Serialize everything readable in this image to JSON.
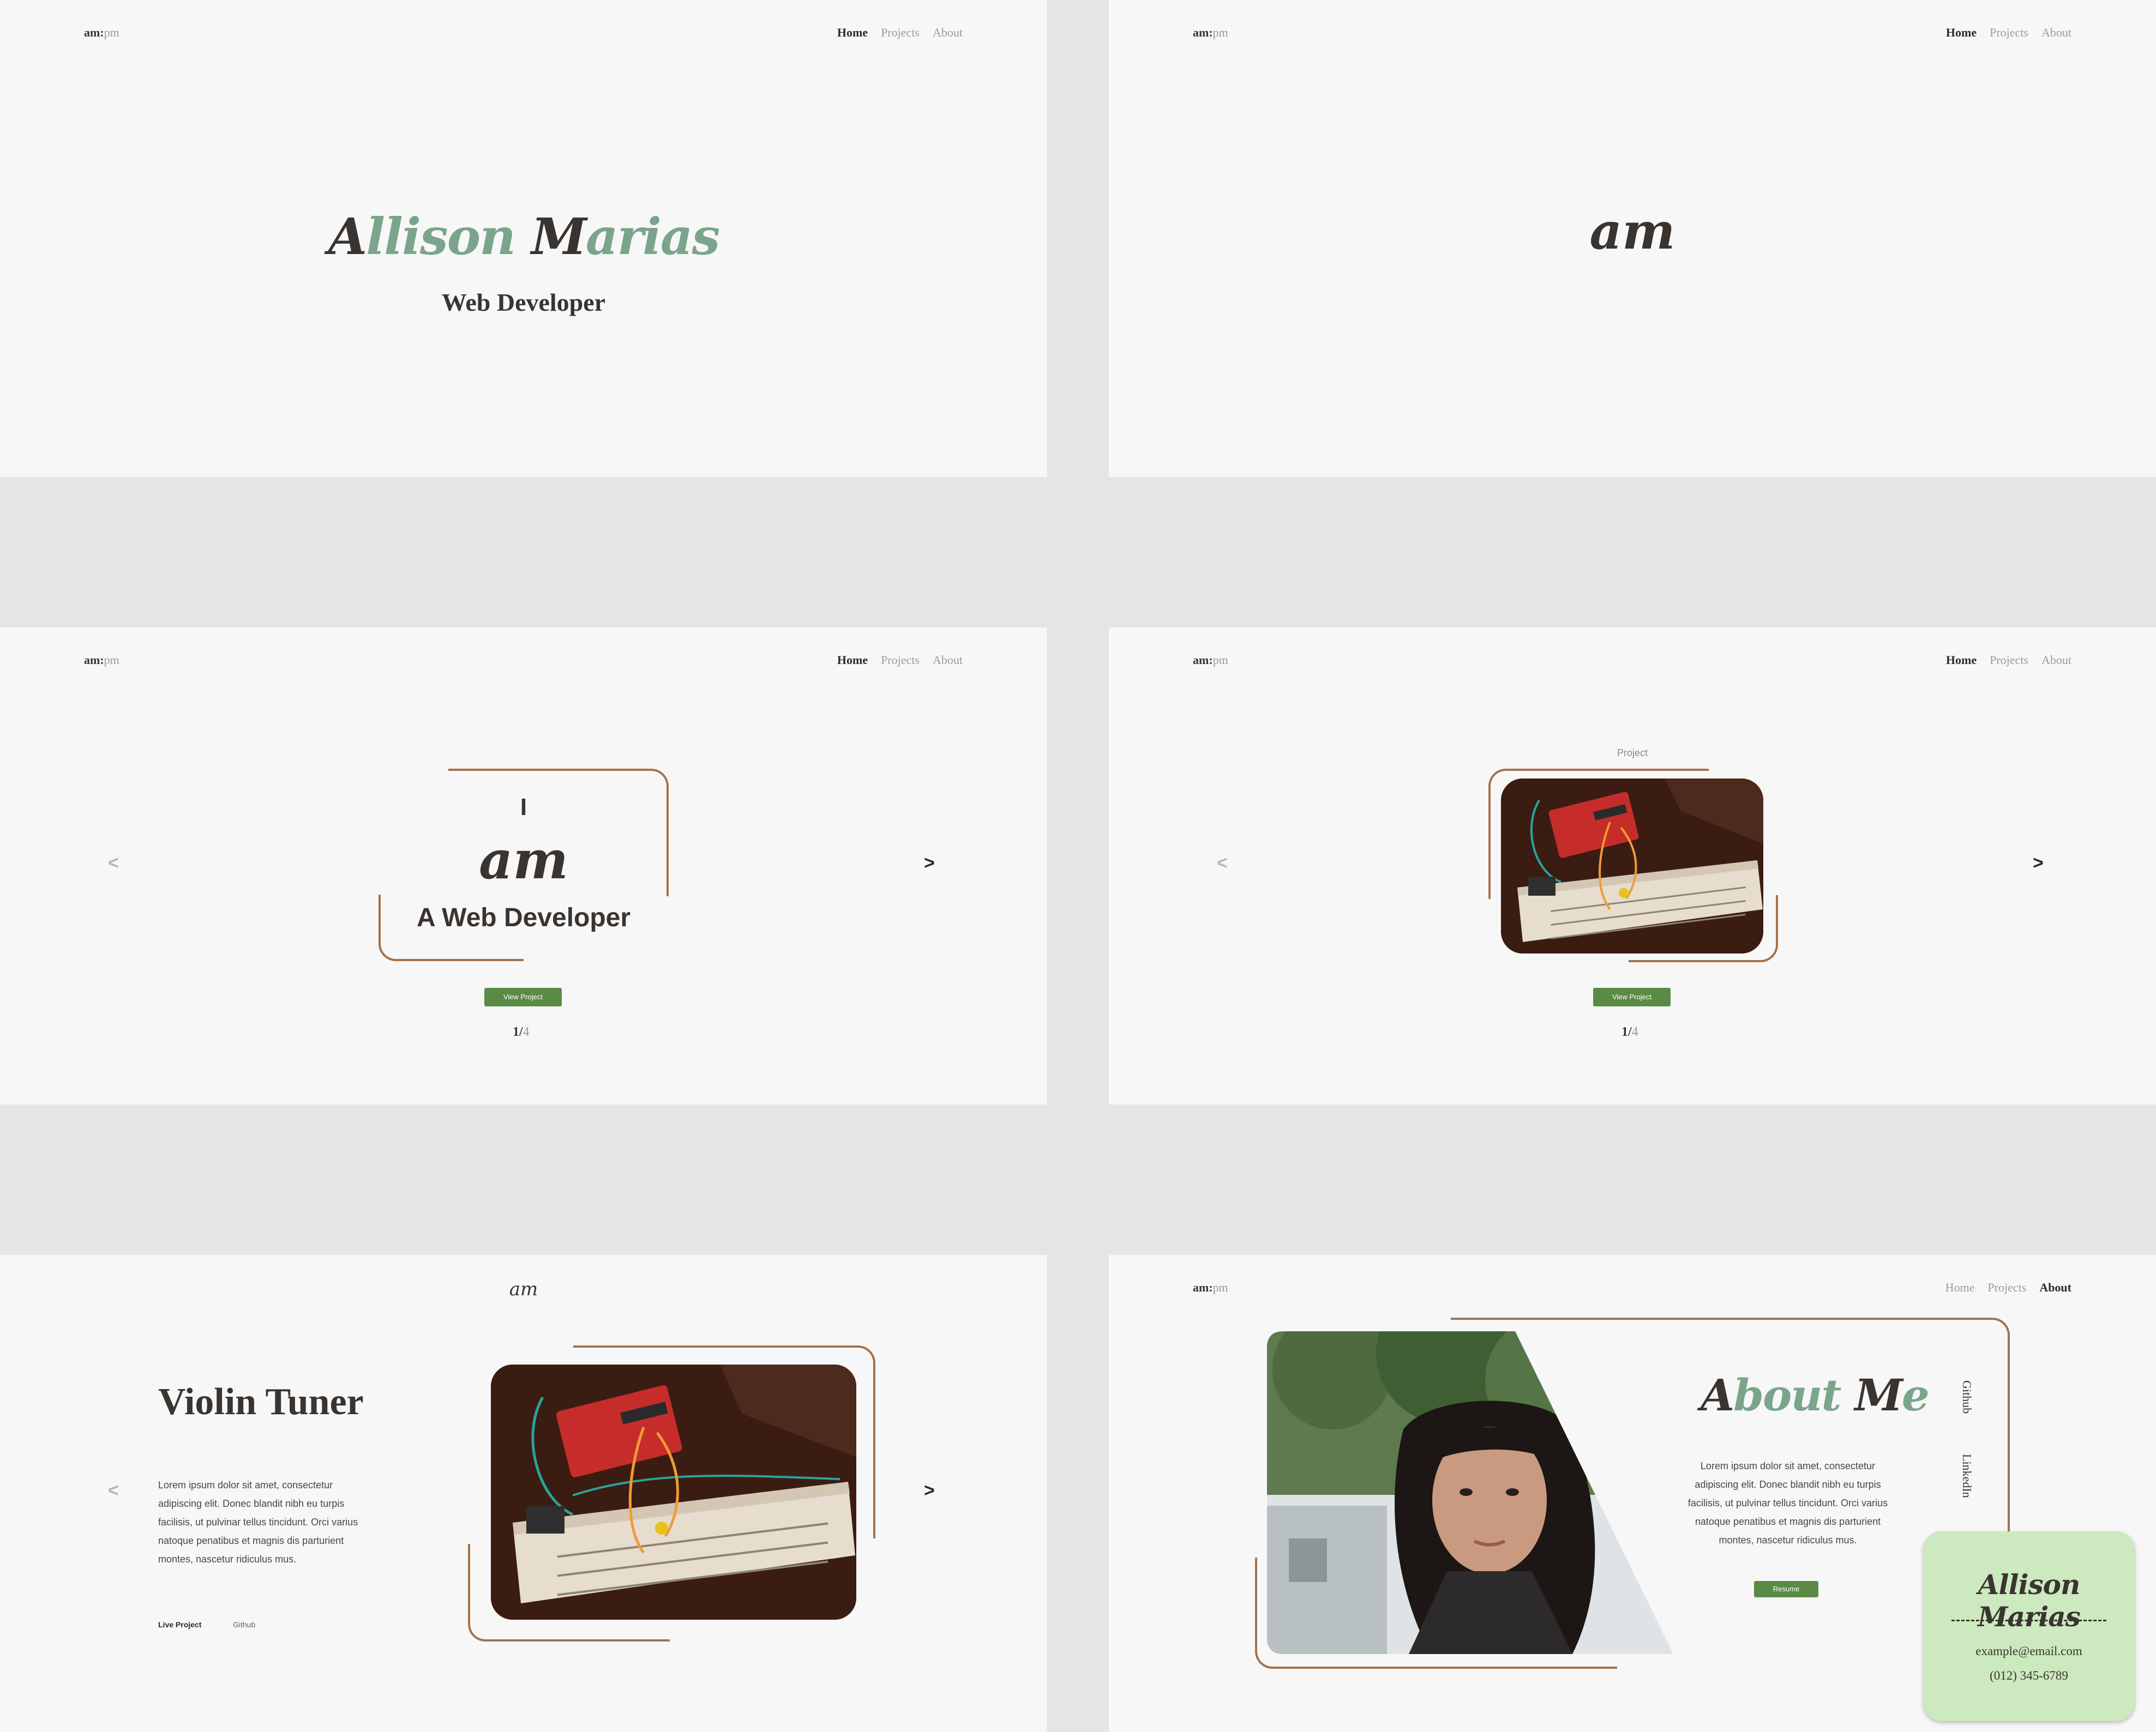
{
  "brand": {
    "am": "am:",
    "pm": "pm"
  },
  "nav": {
    "home": "Home",
    "projects": "Projects",
    "about": "About"
  },
  "hero": {
    "name_first_cap": "A",
    "name_first_rest": "llison",
    "name_last_cap": "M",
    "name_last_rest": "arias",
    "role": "Web Developer"
  },
  "splash": {
    "mark": "am"
  },
  "slide_intro": {
    "line1": "I",
    "line2": "am",
    "line3": "A Web Developer"
  },
  "slider": {
    "prev": "<",
    "next": ">",
    "button": "View Project",
    "current": "1",
    "sep": "/",
    "total": "4",
    "caption": "Project"
  },
  "project": {
    "mark": "am",
    "title": "Violin Tuner",
    "description": "Lorem ipsum dolor sit amet, consectetur adipiscing elit. Donec blandit nibh eu turpis facilisis, ut pulvinar tellus tincidunt. Orci varius natoque penatibus et magnis dis parturient montes, nascetur ridiculus mus.",
    "live": "Live Project",
    "github": "Github",
    "prev": "<",
    "next": ">"
  },
  "about": {
    "title_cap1": "A",
    "title_rest1": "bout",
    "title_cap2": "M",
    "title_rest2": "e",
    "description": "Lorem ipsum dolor sit amet, consectetur adipiscing elit. Donec blandit nibh eu turpis facilisis, ut pulvinar tellus tincidunt. Orci varius natoque penatibus et magnis dis parturient montes, nascetur ridiculus mus.",
    "resume": "Resume",
    "github": "Github",
    "linkedin": "LinkedIn"
  },
  "card": {
    "name": "Allison Marias",
    "email": "example@email.com",
    "phone": "(012) 345-6789"
  },
  "colors": {
    "accent_green": "#7aa58a",
    "button_green": "#5a8b45",
    "frame_brown": "#a3724c",
    "card_bg": "#cce9bf",
    "text_dark": "#3a3430"
  }
}
